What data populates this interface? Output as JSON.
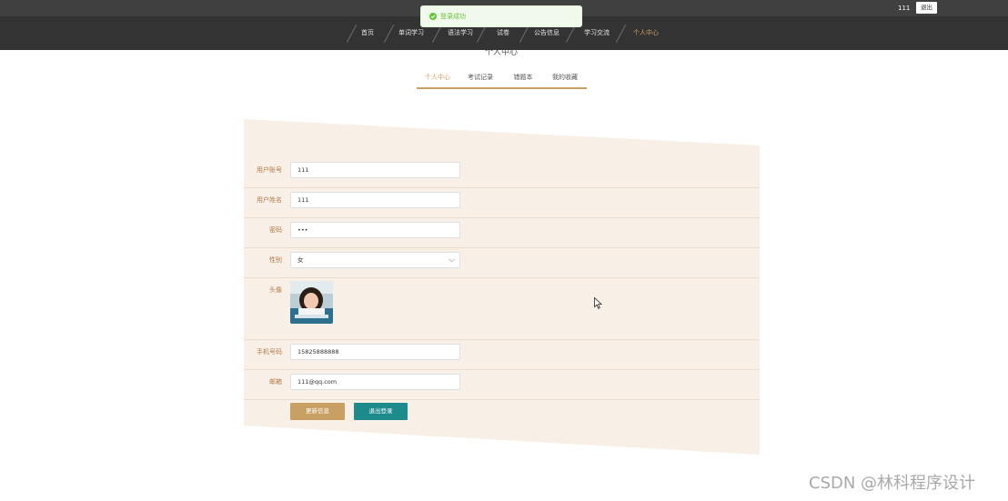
{
  "header": {
    "user": "111",
    "logout": "退出"
  },
  "toast": {
    "text": "登录成功"
  },
  "nav": {
    "items": [
      "首页",
      "单词学习",
      "语法学习",
      "试卷",
      "公告信息",
      "学习交流",
      "个人中心"
    ],
    "active_index": 6
  },
  "page": {
    "title": "个人中心"
  },
  "tabs": [
    "个人中心",
    "考试记录",
    "错题本",
    "我的收藏"
  ],
  "form": {
    "account": {
      "label": "用户账号",
      "value": "111"
    },
    "name": {
      "label": "用户姓名",
      "value": "111"
    },
    "password": {
      "label": "密码",
      "value": "•••"
    },
    "gender": {
      "label": "性别",
      "value": "女"
    },
    "avatar": {
      "label": "头像"
    },
    "phone": {
      "label": "手机号码",
      "value": "15825888888"
    },
    "email": {
      "label": "邮箱",
      "value": "111@qq.com"
    },
    "buttons": {
      "update": "更新信息",
      "logout": "退出登录"
    }
  },
  "watermark": "CSDN @林科程序设计",
  "colors": {
    "nav_bg": "#333333",
    "accent": "#c9a063",
    "teal": "#1d8a8c",
    "panel_bg": "#f8efe6",
    "toast_green": "#67c23a"
  }
}
